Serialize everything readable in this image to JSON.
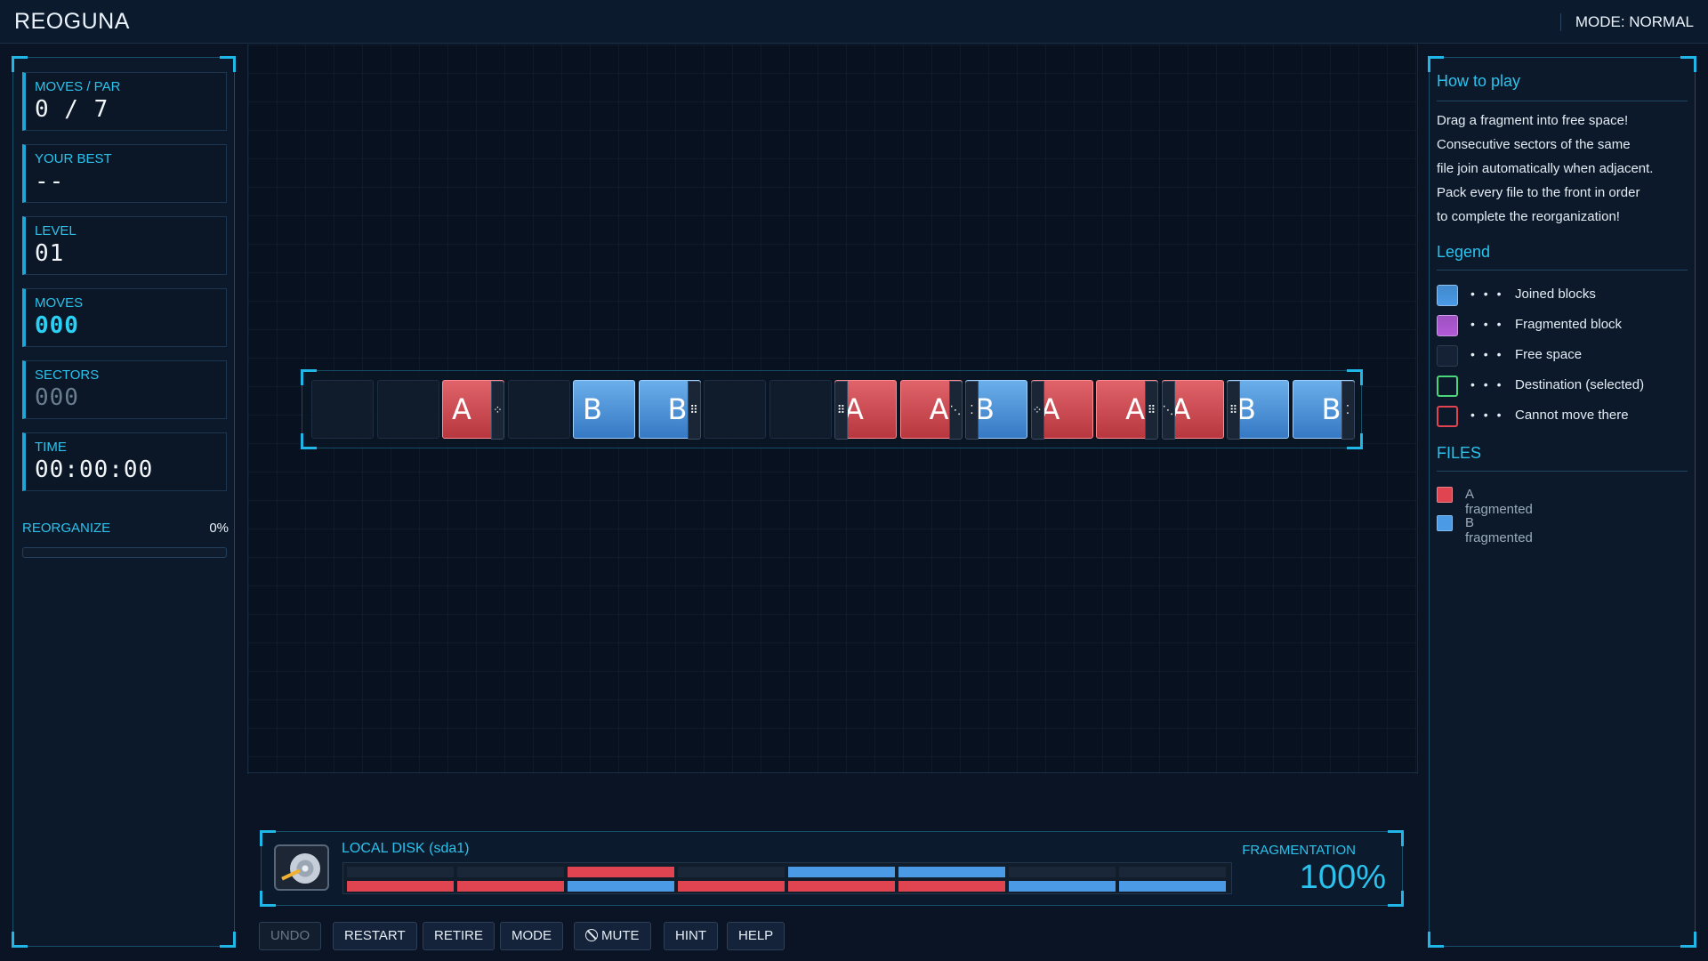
{
  "app": {
    "title": "REOGUNA",
    "mode_label": "MODE: NORMAL"
  },
  "stats": [
    {
      "label": "MOVES / PAR",
      "value": "0 / 7",
      "style": "normal"
    },
    {
      "label": "YOUR BEST",
      "value": "--",
      "style": "normal"
    },
    {
      "label": "LEVEL",
      "value": "01",
      "style": "normal"
    },
    {
      "label": "MOVES",
      "value": "000",
      "style": "cyan"
    },
    {
      "label": "SECTORS",
      "value": "000",
      "style": "dim"
    },
    {
      "label": "TIME",
      "value": "00:00:00",
      "style": "normal"
    }
  ],
  "reorganize": {
    "label": "REORGANIZE",
    "percent_text": "0%",
    "progress": 0
  },
  "track": [
    {
      "type": "free"
    },
    {
      "type": "free"
    },
    {
      "type": "red",
      "left": "A",
      "right": "",
      "handle_right": "⁘"
    },
    {
      "type": "free"
    },
    {
      "type": "blue",
      "left": "B",
      "right": "",
      "handle_right": ""
    },
    {
      "type": "blue",
      "left": "",
      "right": "B",
      "handle_right": "⠿"
    },
    {
      "type": "free"
    },
    {
      "type": "free"
    },
    {
      "type": "red",
      "left": "A",
      "right": "",
      "handle_left": "⠿"
    },
    {
      "type": "red",
      "left": "",
      "right": "A",
      "handle_right": "⋱"
    },
    {
      "type": "blue",
      "left": "B",
      "right": "",
      "handle_left": "⁚"
    },
    {
      "type": "red",
      "left": "A",
      "right": "",
      "handle_left": "⁘"
    },
    {
      "type": "red",
      "left": "",
      "right": "A",
      "handle_right": "⠿"
    },
    {
      "type": "red",
      "left": "A",
      "right": "",
      "handle_left": "⋱"
    },
    {
      "type": "blue",
      "left": "B",
      "right": "",
      "handle_left": "⠿"
    },
    {
      "type": "blue",
      "left": "",
      "right": "B",
      "handle_right": "⁚"
    }
  ],
  "disk": {
    "name": "LOCAL DISK (sda1)",
    "fragmentation_label": "FRAGMENTATION",
    "fragmentation_value": "100%",
    "map_top": [
      "",
      "",
      "red",
      "",
      "blue",
      "blue",
      "",
      ""
    ],
    "map_bottom": [
      "red",
      "red",
      "blue",
      "red",
      "red",
      "red",
      "blue",
      "blue"
    ]
  },
  "toolbar": [
    "UNDO",
    "RESTART",
    "RETIRE",
    "MODE",
    "MUTE",
    "HINT",
    "HELP"
  ],
  "help": {
    "title": "How to play",
    "lines": [
      "Drag a fragment into free space!",
      "Consecutive sectors of the same",
      "file join automatically when adjacent.",
      "Pack every file to the front in order",
      "to complete the reorganization!"
    ]
  },
  "legend": {
    "title": "Legend",
    "items": [
      {
        "label": "Joined blocks",
        "color": "#4a9ae6"
      },
      {
        "label": "Fragmented block",
        "color": "#b45ad8"
      },
      {
        "label": "Free space",
        "color": "#152235"
      },
      {
        "label": "Destination (selected)",
        "color": "#4ad67a"
      },
      {
        "label": "Cannot move there",
        "color": "#e04450"
      }
    ]
  },
  "files": {
    "title": "FILES",
    "items": [
      {
        "label": "A  fragmented",
        "color": "#e04450"
      },
      {
        "label": "B  fragmented",
        "color": "#4a9ae6"
      }
    ]
  }
}
